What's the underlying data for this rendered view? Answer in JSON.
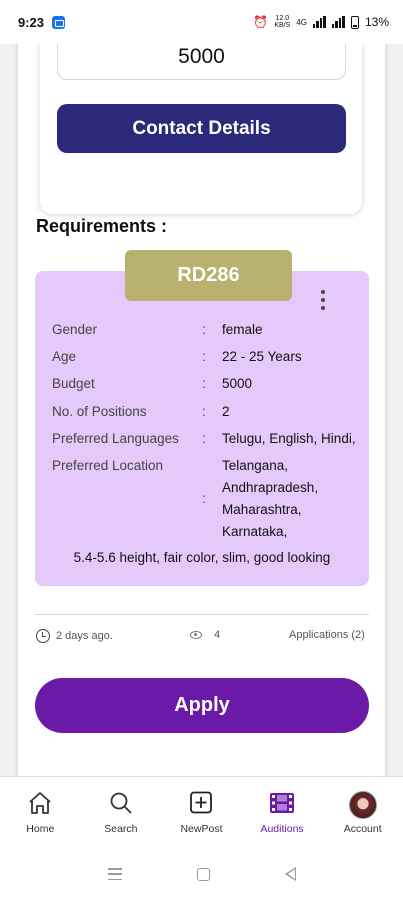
{
  "status_bar": {
    "time": "9:23",
    "network_info": "12.0 KB/S",
    "network_type": "4G",
    "battery": "13%"
  },
  "inner_card": {
    "budget_value": "5000",
    "contact_button": "Contact Details"
  },
  "requirements": {
    "title": "Requirements :",
    "code": "RD286",
    "separator": ":",
    "rows": [
      {
        "key": "Gender",
        "value": "female"
      },
      {
        "key": "Age",
        "value": "22 - 25 Years"
      },
      {
        "key": "Budget",
        "value": "5000"
      },
      {
        "key": "No. of Positions",
        "value": "2"
      },
      {
        "key": "Preferred Languages",
        "value": "Telugu, English, Hindi,"
      },
      {
        "key": "Preferred Location",
        "value_lines": [
          "Telangana,",
          "Andhrapradesh,",
          "Maharashtra,",
          "Karnataka,"
        ]
      }
    ],
    "description": "5.4-5.6 height, fair color, slim, good looking"
  },
  "meta": {
    "posted": "2 days ago.",
    "views": "4",
    "applications": "Applications (2)"
  },
  "apply_button": "Apply",
  "bottom_nav": {
    "items": [
      {
        "label": "Home",
        "icon": "home-icon"
      },
      {
        "label": "Search",
        "icon": "search-icon"
      },
      {
        "label": "NewPost",
        "icon": "add-box-icon"
      },
      {
        "label": "Auditions",
        "icon": "film-icon",
        "active": true
      },
      {
        "label": "Account",
        "icon": "avatar"
      }
    ],
    "active_color": "#6b1aa8"
  },
  "colors": {
    "contact_button": "#2b2a7a",
    "requirements_card": "#e6c9fb",
    "code_badge": "#b9b170",
    "apply_button": "#6b1aa8"
  }
}
